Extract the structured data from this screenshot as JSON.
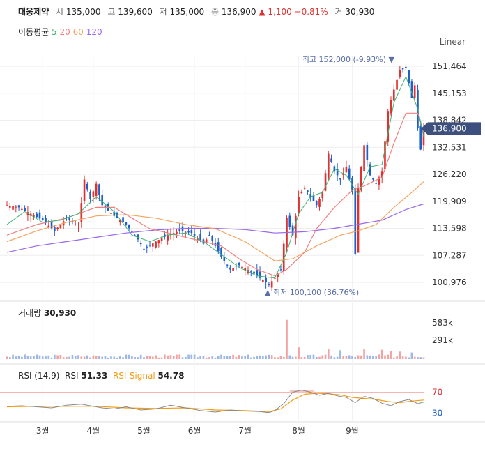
{
  "header": {
    "name": "대웅제약",
    "open_label": "시",
    "open": "135,000",
    "high_label": "고",
    "high": "139,600",
    "low_label": "저",
    "low": "135,000",
    "close_label": "종",
    "close": "136,900",
    "change": "▲ 1,100 +0.81%",
    "volume_label": "거",
    "volume": "30,930"
  },
  "ma_legend": {
    "label": "이동평균",
    "periods": [
      "5",
      "20",
      "60",
      "120"
    ]
  },
  "scale_mode": "Linear",
  "colors": {
    "up": "#e0302f",
    "down": "#1e5fc8",
    "ma5": "#3cb371",
    "ma20": "#f08080",
    "ma60": "#f4a460",
    "ma120": "#9966ee",
    "price_tag": "#3d4f7c",
    "annot": "#5a6fa8"
  },
  "annotations": {
    "high": "최고 152,000 (-9.93%) ▼",
    "low": "▲ 최저 100,100 (36.76%)"
  },
  "price_tag": "136,900",
  "volume_panel": {
    "label": "거래량",
    "value": "30,930",
    "ticks": [
      "583k",
      "291k"
    ]
  },
  "rsi_panel": {
    "label": "RSI (14,9)",
    "rsi_label": "RSI",
    "rsi_value": "51.33",
    "signal_label": "RSI-Signal",
    "signal_value": "54.78",
    "ticks": [
      "70",
      "30"
    ]
  },
  "chart_data": {
    "type": "candlestick",
    "y_ticks": [
      "151,464",
      "145,153",
      "138,842",
      "132,531",
      "126,220",
      "119,909",
      "113,598",
      "107,287",
      "100,976"
    ],
    "ylim": [
      97000,
      155000
    ],
    "x_labels": [
      "3월",
      "4월",
      "5월",
      "6월",
      "7월",
      "8월",
      "9월"
    ],
    "price_path": [
      [
        0,
        119000
      ],
      [
        4,
        118500
      ],
      [
        8,
        117000
      ],
      [
        12,
        115500
      ],
      [
        16,
        113000
      ],
      [
        20,
        116000
      ],
      [
        24,
        114000
      ],
      [
        26,
        125000
      ],
      [
        28,
        120500
      ],
      [
        30,
        124000
      ],
      [
        32,
        119000
      ],
      [
        36,
        116500
      ],
      [
        40,
        114500
      ],
      [
        44,
        111000
      ],
      [
        46,
        108800
      ],
      [
        50,
        110500
      ],
      [
        54,
        112000
      ],
      [
        58,
        113000
      ],
      [
        62,
        112500
      ],
      [
        66,
        110000
      ],
      [
        68,
        112000
      ],
      [
        72,
        107000
      ],
      [
        75,
        104000
      ],
      [
        78,
        105000
      ],
      [
        82,
        103500
      ],
      [
        86,
        101500
      ],
      [
        88,
        100500
      ],
      [
        90,
        102000
      ],
      [
        92,
        104000
      ],
      [
        94,
        116000
      ],
      [
        96,
        112000
      ],
      [
        98,
        121000
      ],
      [
        100,
        123000
      ],
      [
        102,
        121000
      ],
      [
        104,
        119000
      ],
      [
        106,
        122000
      ],
      [
        108,
        131000
      ],
      [
        110,
        127000
      ],
      [
        112,
        125000
      ],
      [
        114,
        128000
      ],
      [
        116,
        122000
      ],
      [
        117,
        107500
      ],
      [
        118,
        123000
      ],
      [
        120,
        133000
      ],
      [
        122,
        126000
      ],
      [
        124,
        124000
      ],
      [
        126,
        127000
      ],
      [
        128,
        141000
      ],
      [
        130,
        146000
      ],
      [
        132,
        150500
      ],
      [
        134,
        151000
      ],
      [
        136,
        144000
      ],
      [
        137,
        147000
      ],
      [
        138,
        137000
      ],
      [
        139,
        132000
      ],
      [
        140,
        136900
      ]
    ],
    "ma5": [
      [
        0,
        114500
      ],
      [
        6,
        117500
      ],
      [
        12,
        115000
      ],
      [
        18,
        115500
      ],
      [
        24,
        117000
      ],
      [
        30,
        121000
      ],
      [
        36,
        117500
      ],
      [
        42,
        112000
      ],
      [
        48,
        110500
      ],
      [
        54,
        112000
      ],
      [
        60,
        112500
      ],
      [
        66,
        110500
      ],
      [
        72,
        107500
      ],
      [
        78,
        104500
      ],
      [
        84,
        102500
      ],
      [
        90,
        102000
      ],
      [
        94,
        108000
      ],
      [
        98,
        117000
      ],
      [
        102,
        121000
      ],
      [
        106,
        122000
      ],
      [
        110,
        127500
      ],
      [
        114,
        126000
      ],
      [
        118,
        121500
      ],
      [
        122,
        128000
      ],
      [
        126,
        128500
      ],
      [
        130,
        143000
      ],
      [
        134,
        149000
      ],
      [
        138,
        141500
      ],
      [
        140,
        135000
      ]
    ],
    "ma20": [
      [
        0,
        112000
      ],
      [
        10,
        114500
      ],
      [
        20,
        116000
      ],
      [
        30,
        118500
      ],
      [
        36,
        118500
      ],
      [
        42,
        116000
      ],
      [
        48,
        113500
      ],
      [
        54,
        112500
      ],
      [
        60,
        111500
      ],
      [
        66,
        110500
      ],
      [
        72,
        109500
      ],
      [
        78,
        106500
      ],
      [
        84,
        104000
      ],
      [
        90,
        102500
      ],
      [
        94,
        104000
      ],
      [
        100,
        108000
      ],
      [
        104,
        113500
      ],
      [
        110,
        118500
      ],
      [
        116,
        122500
      ],
      [
        120,
        123500
      ],
      [
        126,
        125500
      ],
      [
        130,
        133500
      ],
      [
        134,
        140500
      ],
      [
        138,
        140500
      ],
      [
        140,
        136000
      ]
    ],
    "ma60": [
      [
        0,
        110500
      ],
      [
        10,
        113000
      ],
      [
        20,
        115000
      ],
      [
        30,
        116500
      ],
      [
        40,
        116800
      ],
      [
        50,
        116000
      ],
      [
        60,
        114500
      ],
      [
        70,
        113500
      ],
      [
        80,
        110500
      ],
      [
        90,
        106000
      ],
      [
        96,
        106500
      ],
      [
        104,
        109500
      ],
      [
        112,
        112000
      ],
      [
        118,
        113000
      ],
      [
        124,
        114500
      ],
      [
        130,
        118500
      ],
      [
        136,
        122000
      ],
      [
        140,
        124500
      ]
    ],
    "ma120": [
      [
        0,
        108000
      ],
      [
        10,
        109500
      ],
      [
        20,
        110500
      ],
      [
        30,
        111500
      ],
      [
        40,
        112500
      ],
      [
        50,
        113200
      ],
      [
        60,
        113600
      ],
      [
        70,
        113600
      ],
      [
        80,
        113300
      ],
      [
        90,
        112500
      ],
      [
        100,
        112800
      ],
      [
        110,
        113600
      ],
      [
        120,
        114800
      ],
      [
        126,
        115500
      ],
      [
        134,
        118000
      ],
      [
        140,
        119300
      ]
    ],
    "volume_spikes": [
      [
        94,
        0.84
      ],
      [
        98,
        0.25
      ],
      [
        108,
        0.21
      ],
      [
        112,
        0.19
      ],
      [
        120,
        0.22
      ],
      [
        126,
        0.2
      ],
      [
        129,
        0.18
      ],
      [
        132,
        0.16
      ],
      [
        136,
        0.14
      ]
    ],
    "volume_max_k": 583,
    "rsi": [
      [
        0,
        43
      ],
      [
        5,
        44
      ],
      [
        10,
        42
      ],
      [
        15,
        40
      ],
      [
        20,
        45
      ],
      [
        25,
        47
      ],
      [
        28,
        44
      ],
      [
        32,
        40
      ],
      [
        36,
        38
      ],
      [
        40,
        42
      ],
      [
        45,
        36
      ],
      [
        50,
        38
      ],
      [
        55,
        45
      ],
      [
        60,
        40
      ],
      [
        65,
        35
      ],
      [
        70,
        32
      ],
      [
        75,
        36
      ],
      [
        80,
        34
      ],
      [
        85,
        33
      ],
      [
        88,
        31
      ],
      [
        90,
        35
      ],
      [
        93,
        48
      ],
      [
        96,
        70
      ],
      [
        99,
        74
      ],
      [
        102,
        70
      ],
      [
        105,
        64
      ],
      [
        108,
        68
      ],
      [
        111,
        63
      ],
      [
        114,
        60
      ],
      [
        117,
        50
      ],
      [
        120,
        62
      ],
      [
        123,
        58
      ],
      [
        126,
        49
      ],
      [
        129,
        44
      ],
      [
        132,
        52
      ],
      [
        135,
        56
      ],
      [
        138,
        48
      ],
      [
        140,
        51
      ]
    ],
    "rsi_signal": [
      [
        0,
        42
      ],
      [
        10,
        43
      ],
      [
        20,
        43
      ],
      [
        30,
        43
      ],
      [
        40,
        40
      ],
      [
        50,
        39
      ],
      [
        60,
        40
      ],
      [
        70,
        36
      ],
      [
        80,
        35
      ],
      [
        88,
        33
      ],
      [
        92,
        38
      ],
      [
        96,
        55
      ],
      [
        100,
        66
      ],
      [
        104,
        68
      ],
      [
        108,
        67
      ],
      [
        112,
        65
      ],
      [
        116,
        60
      ],
      [
        120,
        58
      ],
      [
        124,
        56
      ],
      [
        128,
        52
      ],
      [
        132,
        50
      ],
      [
        136,
        53
      ],
      [
        140,
        55
      ]
    ]
  }
}
